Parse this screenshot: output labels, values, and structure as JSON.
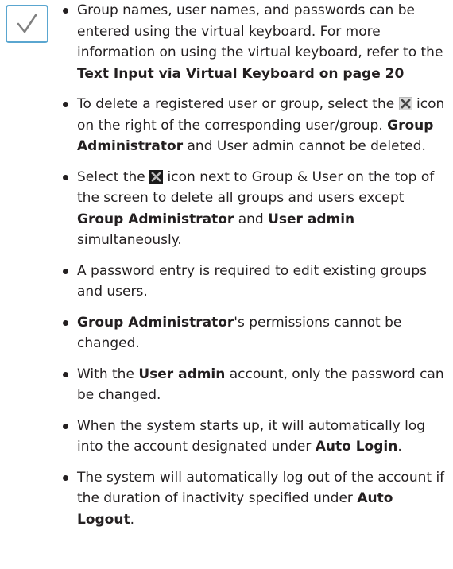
{
  "icons": {
    "note": "check-mark",
    "delete_light": "delete-icon",
    "delete_dark": "delete-all-icon",
    "accent_color": "#5aa6d0"
  },
  "notes": [
    {
      "t1": "Group names, user names, and passwords can be entered using the virtual keyboard. For more information on using the virtual keyboard, refer to the ",
      "link": "Text Input via Virtual Keyboard on page 20"
    },
    {
      "t1": "To delete a registered user or group, select the ",
      "t2": " icon on the right of the corresponding user/group. ",
      "b1": "Group Administrator",
      "t3": " and User admin cannot be deleted."
    },
    {
      "t1": "Select the ",
      "t2": " icon next to Group & User on the top of the screen to delete all groups and users except ",
      "b1": "Group Administrator",
      "t3": " and ",
      "b2": "User admin",
      "t4": " simultaneously."
    },
    {
      "t1": "A password entry is required to edit existing groups and users."
    },
    {
      "b1": "Group Administrator",
      "t1": "'s permissions cannot be changed."
    },
    {
      "t1": "With the ",
      "b1": "User admin",
      "t2": " account, only the password can be changed."
    },
    {
      "t1": "When the system starts up, it will automatically log into the account designated under ",
      "b1": "Auto Login",
      "t2": "."
    },
    {
      "t1": "The system will automatically log out of the account if the duration of inactivity specified under ",
      "b1": "Auto Logout",
      "t2": "."
    }
  ]
}
